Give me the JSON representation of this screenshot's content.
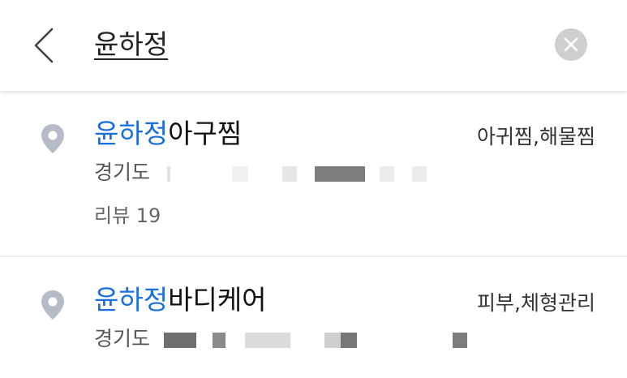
{
  "search": {
    "query": "윤하정"
  },
  "results": [
    {
      "name_highlight": "윤하정",
      "name_rest": "아구찜",
      "category": "아귀찜,해물찜",
      "address": "경기도",
      "review": "리뷰 19"
    },
    {
      "name_highlight": "윤하정",
      "name_rest": "바디케어",
      "category": "피부,체형관리",
      "address": "경기도"
    }
  ],
  "colors": {
    "highlight": "#1a6fe0",
    "pin": "#b5bcc8",
    "clear_button": "#cfcfcf"
  },
  "icons": {
    "back": "chevron-left-icon",
    "clear": "close-circle-icon",
    "pin": "map-pin-icon"
  }
}
